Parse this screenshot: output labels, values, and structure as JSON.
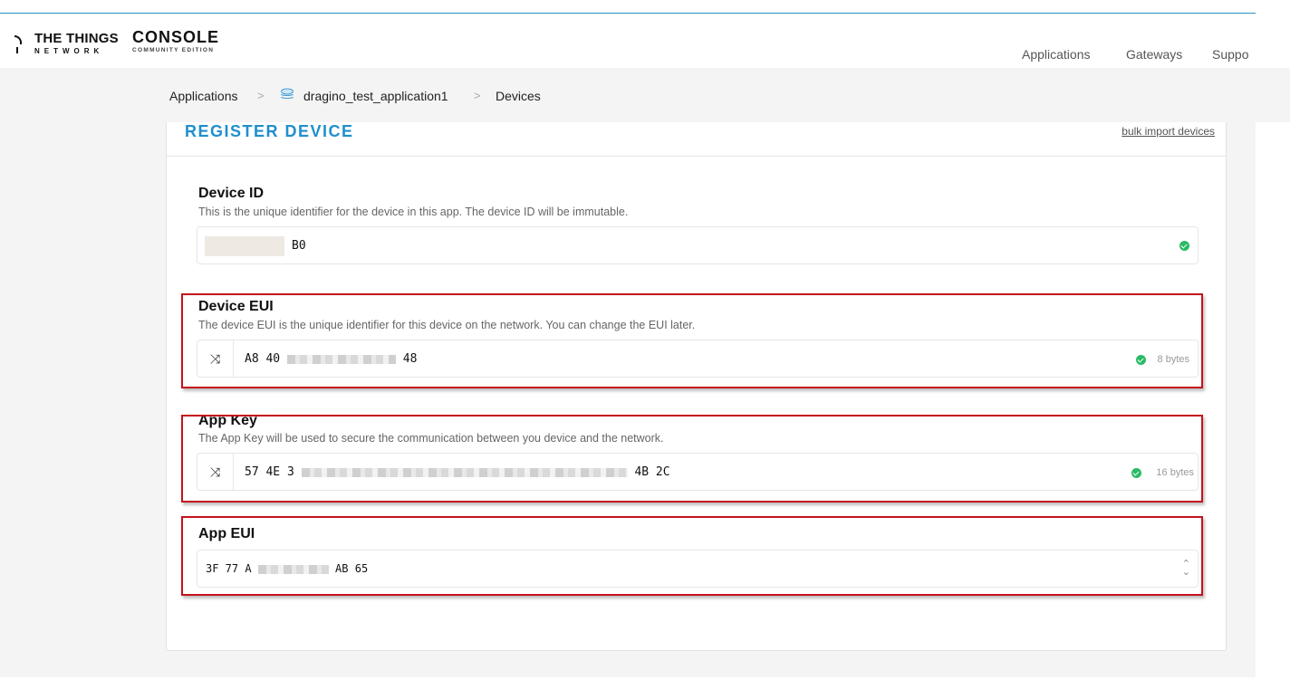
{
  "header": {
    "brand_top": "THE THINGS",
    "brand_sub": "NETWORK",
    "console_title": "CONSOLE",
    "console_sub": "COMMUNITY EDITION",
    "nav": [
      "Applications",
      "Gateways",
      "Suppo"
    ]
  },
  "breadcrumb": {
    "items": [
      "Applications",
      "dragino_test_application1",
      "Devices"
    ],
    "separator": ">"
  },
  "card": {
    "title": "REGISTER DEVICE",
    "bulk_link": "bulk import devices"
  },
  "fields": {
    "device_id": {
      "label": "Device ID",
      "description": "This is the unique identifier for the device in this app. The device ID will be immutable.",
      "value_visible": "B0"
    },
    "device_eui": {
      "label": "Device EUI",
      "description": "The device EUI is the unique identifier for this device on the network. You can change the EUI later.",
      "value_start": "A8 40",
      "value_end": "48",
      "size": "8 bytes"
    },
    "app_key": {
      "label": "App Key",
      "description": "The App Key will be used to secure the communication between you device and the network.",
      "value_start": "57 4E 3",
      "value_end": "4B 2C",
      "size": "16 bytes"
    },
    "app_eui": {
      "label": "App EUI",
      "value_start": "3F 77 A",
      "value_end": "AB 65"
    }
  },
  "icons": {
    "generate": "shuffle-icon",
    "valid": "check-circle-icon",
    "select": "select-arrows-icon"
  },
  "colors": {
    "accent": "#1f8fce",
    "valid": "#2bba67",
    "highlight": "#c4121c"
  }
}
